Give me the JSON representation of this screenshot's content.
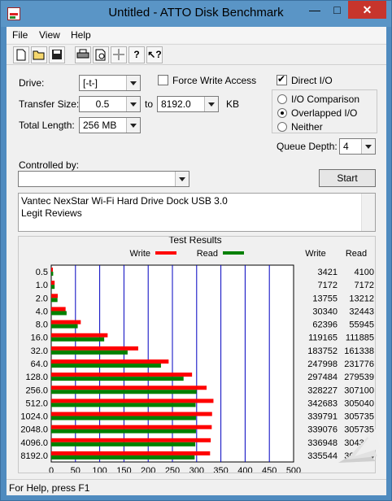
{
  "window": {
    "title": "Untitled - ATTO Disk Benchmark"
  },
  "menu": [
    "File",
    "View",
    "Help"
  ],
  "toolbar": [
    "new-document",
    "open-folder",
    "save",
    "print",
    "print-preview",
    "move",
    "help",
    "context-help"
  ],
  "settings": {
    "drive_label": "Drive:",
    "drive_value": "[-t-]",
    "force_write_label": "Force Write Access",
    "force_write_checked": false,
    "direct_io_label": "Direct I/O",
    "direct_io_checked": true,
    "transfer_size_label": "Transfer Size:",
    "transfer_from": "0.5",
    "to_label": "to",
    "transfer_to": "8192.0",
    "kb_label": "KB",
    "total_length_label": "Total Length:",
    "total_length_value": "256 MB",
    "io_comparison_label": "I/O Comparison",
    "overlapped_io_label": "Overlapped I/O",
    "neither_label": "Neither",
    "selected_io_mode": "Overlapped I/O",
    "queue_depth_label": "Queue Depth:",
    "queue_depth_value": "4",
    "controlled_by_label": "Controlled by:",
    "controlled_by_value": "",
    "start_label": "Start"
  },
  "description": [
    "Vantec NexStar Wi-Fi Hard Drive Dock USB 3.0",
    "Legit Reviews"
  ],
  "chart_data": {
    "type": "bar",
    "title": "Test Results",
    "orientation": "horizontal",
    "categories": [
      "0.5",
      "1.0",
      "2.0",
      "4.0",
      "8.0",
      "16.0",
      "32.0",
      "64.0",
      "128.0",
      "256.0",
      "512.0",
      "1024.0",
      "2048.0",
      "4096.0",
      "8192.0"
    ],
    "series": [
      {
        "name": "Write",
        "color": "#ff0000",
        "values": [
          3421,
          7172,
          13755,
          30340,
          62396,
          119165,
          183752,
          247998,
          297484,
          328227,
          342683,
          339791,
          339076,
          336948,
          335544
        ]
      },
      {
        "name": "Read",
        "color": "#008000",
        "values": [
          4100,
          7172,
          13212,
          32443,
          55945,
          111885,
          161338,
          231776,
          279539,
          307100,
          305040,
          305735,
          305735,
          304348,
          302974
        ]
      }
    ],
    "column_headers": [
      "Write",
      "Read"
    ],
    "xlabel": "Transfer Rate - MB / Sec",
    "xlim": [
      0,
      500
    ],
    "xticks": [
      "0",
      "50",
      "100",
      "150",
      "200",
      "250",
      "300",
      "350",
      "400",
      "450",
      "500"
    ],
    "grid": true,
    "legend": "top"
  },
  "status": {
    "text": "For Help, press F1"
  },
  "colors": {
    "titlebar": "#5a95c6",
    "close": "#c7352c",
    "grid": "#0000c0",
    "write": "#ff0000",
    "read": "#008000"
  }
}
